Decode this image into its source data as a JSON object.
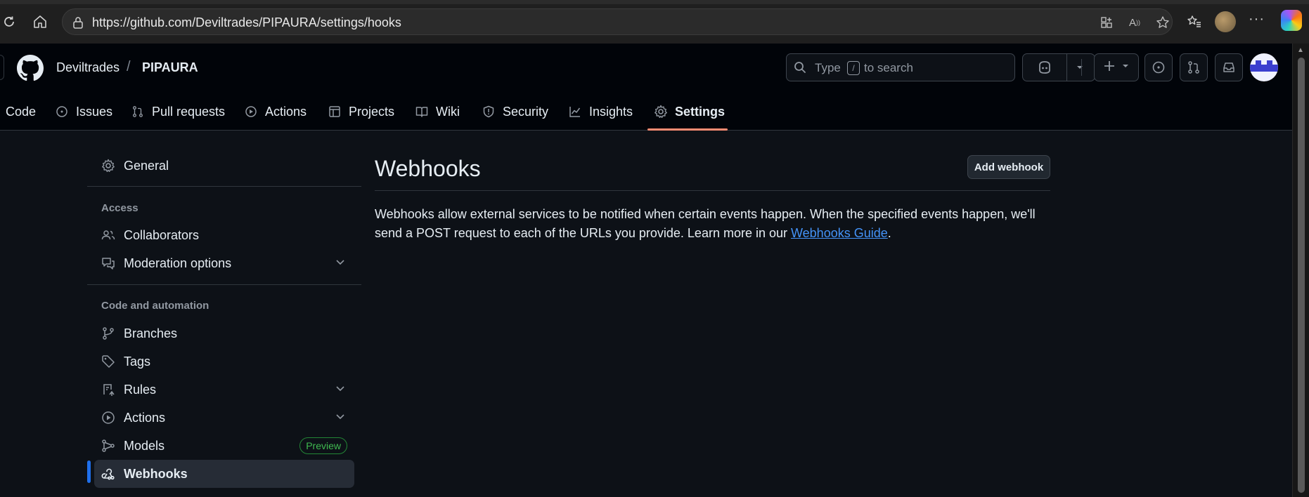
{
  "browser": {
    "url": "https://github.com/Deviltrades/PIPAURA/settings/hooks"
  },
  "header": {
    "owner": "Deviltrades",
    "separator": "/",
    "repo": "PIPAURA",
    "search_placeholder_before": "Type",
    "search_key": "/",
    "search_placeholder_after": "to search"
  },
  "tabs": [
    {
      "label": "Code",
      "icon": "code-icon"
    },
    {
      "label": "Issues",
      "icon": "issue-icon"
    },
    {
      "label": "Pull requests",
      "icon": "pull-request-icon"
    },
    {
      "label": "Actions",
      "icon": "play-icon"
    },
    {
      "label": "Projects",
      "icon": "table-icon"
    },
    {
      "label": "Wiki",
      "icon": "book-icon"
    },
    {
      "label": "Security",
      "icon": "shield-icon"
    },
    {
      "label": "Insights",
      "icon": "graph-icon"
    },
    {
      "label": "Settings",
      "icon": "gear-icon",
      "active": true
    }
  ],
  "sidebar": {
    "general": "General",
    "access_heading": "Access",
    "collaborators": "Collaborators",
    "moderation": "Moderation options",
    "code_heading": "Code and automation",
    "branches": "Branches",
    "tags": "Tags",
    "rules": "Rules",
    "actions": "Actions",
    "models": "Models",
    "models_badge": "Preview",
    "webhooks": "Webhooks"
  },
  "main": {
    "title": "Webhooks",
    "add_button": "Add webhook",
    "description_before": "Webhooks allow external services to be notified when certain events happen. When the specified events happen, we'll send a POST request to each of the URLs you provide. Learn more in our ",
    "guide_link": "Webhooks Guide",
    "description_after": "."
  },
  "colors": {
    "background": "#0d1117",
    "header_background": "#010409",
    "active_tab_underline": "#fd8c73",
    "active_marker": "#1f6feb",
    "link": "#4493f8",
    "preview_badge": "#3fb950"
  }
}
